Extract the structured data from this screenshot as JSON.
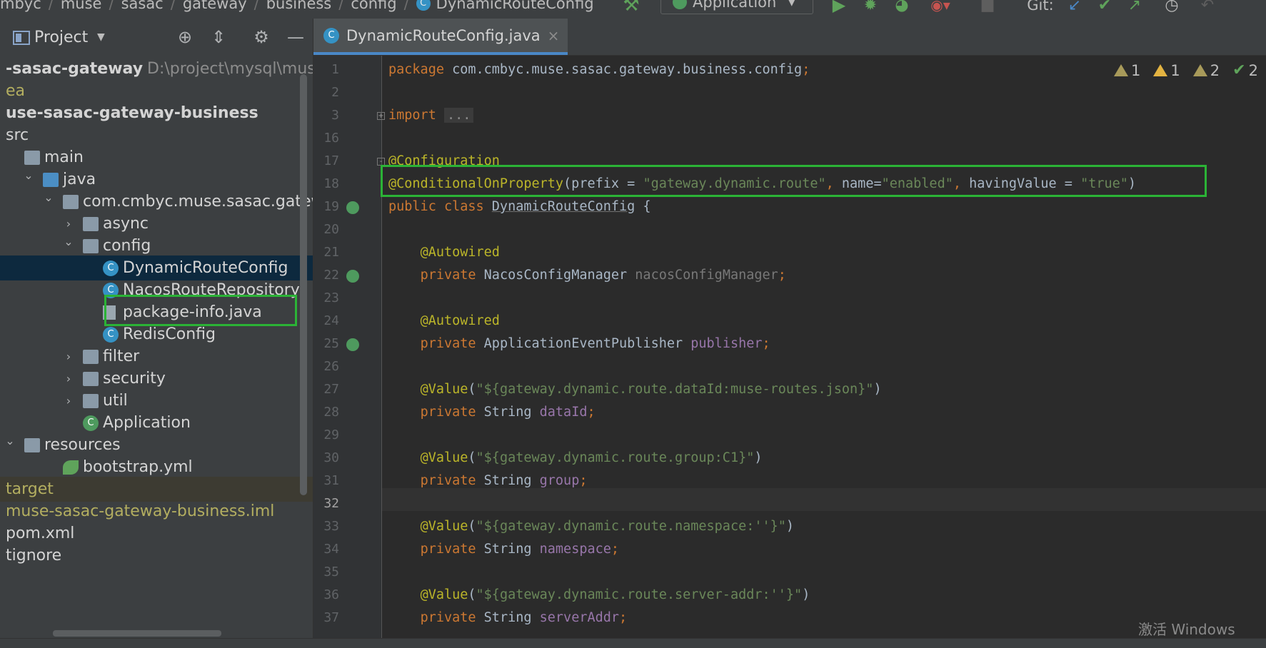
{
  "breadcrumb": [
    "mbyc",
    "muse",
    "sasac",
    "gateway",
    "business",
    "config",
    "DynamicRouteConfig"
  ],
  "toolbar": {
    "run_config": "Application",
    "git_label": "Git:"
  },
  "project_panel": {
    "title": "Project",
    "tree": [
      {
        "label": "-sasac-gateway",
        "path": "D:\\project\\mysql\\muse-",
        "indent": 0,
        "icon": "none",
        "bold": true,
        "color": "#d4d4d4"
      },
      {
        "label": "ea",
        "indent": 0,
        "icon": "none",
        "color": "#b3ae60"
      },
      {
        "label": "use-sasac-gateway-business",
        "indent": 0,
        "icon": "none",
        "bold": true,
        "color": "#d4d4d4"
      },
      {
        "label": "src",
        "indent": 0,
        "icon": "none",
        "color": "#d4d4d4"
      },
      {
        "label": "main",
        "indent": 1,
        "icon": "folder",
        "color": "#d4d4d4"
      },
      {
        "label": "java",
        "indent": 2,
        "icon": "folder-blue",
        "arrow": "v",
        "color": "#d4d4d4"
      },
      {
        "label": "com.cmbyc.muse.sasac.gateway.",
        "indent": 3,
        "icon": "folder",
        "arrow": "v",
        "color": "#d4d4d4"
      },
      {
        "label": "async",
        "indent": 4,
        "icon": "folder",
        "arrow": ">",
        "color": "#d4d4d4"
      },
      {
        "label": "config",
        "indent": 4,
        "icon": "folder",
        "arrow": "v",
        "color": "#d4d4d4"
      },
      {
        "label": "DynamicRouteConfig",
        "indent": 5,
        "icon": "class",
        "selected": true,
        "color": "#d4d4d4"
      },
      {
        "label": "NacosRouteRepository",
        "indent": 5,
        "icon": "class",
        "color": "#d4d4d4"
      },
      {
        "label": "package-info.java",
        "indent": 5,
        "icon": "file",
        "color": "#d4d4d4"
      },
      {
        "label": "RedisConfig",
        "indent": 5,
        "icon": "class",
        "color": "#d4d4d4"
      },
      {
        "label": "filter",
        "indent": 4,
        "icon": "folder",
        "arrow": ">",
        "color": "#d4d4d4"
      },
      {
        "label": "security",
        "indent": 4,
        "icon": "folder",
        "arrow": ">",
        "color": "#d4d4d4"
      },
      {
        "label": "util",
        "indent": 4,
        "icon": "folder",
        "arrow": ">",
        "color": "#d4d4d4"
      },
      {
        "label": "Application",
        "indent": 4,
        "icon": "app",
        "color": "#d4d4d4"
      },
      {
        "label": "resources",
        "indent": 1,
        "icon": "folder-res",
        "arrow": "v",
        "color": "#d4d4d4"
      },
      {
        "label": "bootstrap.yml",
        "indent": 3,
        "icon": "yml",
        "color": "#d4d4d4"
      },
      {
        "label": "target",
        "indent": 0,
        "icon": "none",
        "target": true,
        "color": "#b3ae60"
      },
      {
        "label": "muse-sasac-gateway-business.iml",
        "indent": 0,
        "icon": "none",
        "color": "#b3ae60"
      },
      {
        "label": "pom.xml",
        "indent": 0,
        "icon": "none",
        "color": "#d4d4d4"
      },
      {
        "label": "tignore",
        "indent": 0,
        "icon": "none",
        "color": "#d4d4d4"
      }
    ]
  },
  "editor": {
    "tab_label": "DynamicRouteConfig.java",
    "inspections": [
      "1",
      "1",
      "2",
      "2"
    ],
    "lines": [
      {
        "n": "1",
        "tokens": [
          [
            "kw",
            "package "
          ],
          [
            "",
            "com.cmbyc.muse.sasac.gateway.business.config"
          ],
          [
            "kw",
            ";"
          ]
        ]
      },
      {
        "n": "2",
        "tokens": []
      },
      {
        "n": "3",
        "fold": "+",
        "tokens": [
          [
            "kw",
            "import "
          ],
          [
            "dots",
            "..."
          ]
        ]
      },
      {
        "n": "16",
        "tokens": []
      },
      {
        "n": "17",
        "fold": "-",
        "tokens": [
          [
            "ann",
            "@Configuration"
          ]
        ]
      },
      {
        "n": "18",
        "tokens": [
          [
            "ann",
            "@ConditionalOnProperty"
          ],
          [
            "",
            "(prefix = "
          ],
          [
            "str",
            "\"gateway.dynamic.route\""
          ],
          [
            "kw",
            ", "
          ],
          [
            "",
            "name="
          ],
          [
            "str",
            "\"enabled\""
          ],
          [
            "kw",
            ", "
          ],
          [
            "",
            "havingValue = "
          ],
          [
            "str",
            "\"true\""
          ],
          [
            "",
            ")"
          ]
        ]
      },
      {
        "n": "19",
        "gutter": true,
        "tokens": [
          [
            "kw",
            "public class "
          ],
          [
            "u",
            "DynamicRouteConfig"
          ],
          [
            "",
            " {"
          ]
        ]
      },
      {
        "n": "20",
        "tokens": []
      },
      {
        "n": "21",
        "tokens": [
          [
            "",
            "    "
          ],
          [
            "ann",
            "@Autowired"
          ]
        ]
      },
      {
        "n": "22",
        "gutter": true,
        "tokens": [
          [
            "",
            "    "
          ],
          [
            "kw",
            "private "
          ],
          [
            "",
            "NacosConfigManager "
          ],
          [
            "dim",
            "nacosConfigManager"
          ],
          [
            "kw",
            ";"
          ]
        ]
      },
      {
        "n": "23",
        "tokens": []
      },
      {
        "n": "24",
        "tokens": [
          [
            "",
            "    "
          ],
          [
            "ann",
            "@Autowired"
          ]
        ]
      },
      {
        "n": "25",
        "gutter": true,
        "tokens": [
          [
            "",
            "    "
          ],
          [
            "kw",
            "private "
          ],
          [
            "",
            "ApplicationEventPublisher "
          ],
          [
            "fld",
            "publisher"
          ],
          [
            "kw",
            ";"
          ]
        ]
      },
      {
        "n": "26",
        "tokens": []
      },
      {
        "n": "27",
        "tokens": [
          [
            "",
            "    "
          ],
          [
            "ann",
            "@Value"
          ],
          [
            "",
            "("
          ],
          [
            "str",
            "\"${gateway.dynamic.route.dataId:muse-routes.json}\""
          ],
          [
            "",
            ")"
          ]
        ]
      },
      {
        "n": "28",
        "tokens": [
          [
            "",
            "    "
          ],
          [
            "kw",
            "private "
          ],
          [
            "",
            "String "
          ],
          [
            "fld",
            "dataId"
          ],
          [
            "kw",
            ";"
          ]
        ]
      },
      {
        "n": "29",
        "tokens": []
      },
      {
        "n": "30",
        "tokens": [
          [
            "",
            "    "
          ],
          [
            "ann",
            "@Value"
          ],
          [
            "",
            "("
          ],
          [
            "str",
            "\"${gateway.dynamic.route.group:C1}\""
          ],
          [
            "",
            ")"
          ]
        ]
      },
      {
        "n": "31",
        "tokens": [
          [
            "",
            "    "
          ],
          [
            "kw",
            "private "
          ],
          [
            "",
            "String "
          ],
          [
            "fld",
            "group"
          ],
          [
            "kw",
            ";"
          ]
        ]
      },
      {
        "n": "32",
        "current": true,
        "tokens": []
      },
      {
        "n": "33",
        "tokens": [
          [
            "",
            "    "
          ],
          [
            "ann",
            "@Value"
          ],
          [
            "",
            "("
          ],
          [
            "str",
            "\"${gateway.dynamic.route.namespace:''}\""
          ],
          [
            "",
            ")"
          ]
        ]
      },
      {
        "n": "34",
        "tokens": [
          [
            "",
            "    "
          ],
          [
            "kw",
            "private "
          ],
          [
            "",
            "String "
          ],
          [
            "fld",
            "namespace"
          ],
          [
            "kw",
            ";"
          ]
        ]
      },
      {
        "n": "35",
        "tokens": []
      },
      {
        "n": "36",
        "tokens": [
          [
            "",
            "    "
          ],
          [
            "ann",
            "@Value"
          ],
          [
            "",
            "("
          ],
          [
            "str",
            "\"${gateway.dynamic.route.server-addr:''}\""
          ],
          [
            "",
            ")"
          ]
        ]
      },
      {
        "n": "37",
        "tokens": [
          [
            "",
            "    "
          ],
          [
            "kw",
            "private "
          ],
          [
            "",
            "String "
          ],
          [
            "fld",
            "serverAddr"
          ],
          [
            "kw",
            ";"
          ]
        ]
      }
    ]
  },
  "watermark": "激活 Windows",
  "colors": {
    "highlight_box": "#2bb336",
    "selection": "#0d293e",
    "accent_tab": "#4a88c7"
  }
}
